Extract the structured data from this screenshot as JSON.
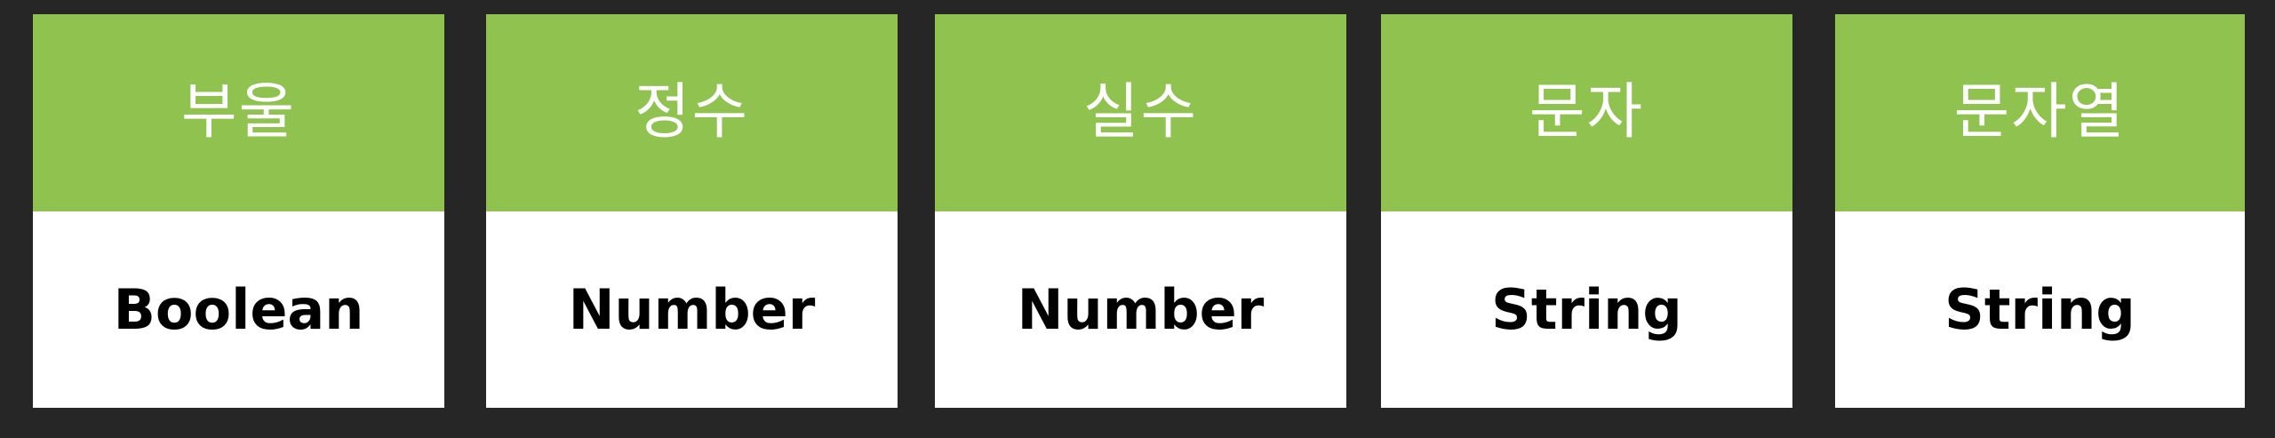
{
  "cards": [
    {
      "korean": "부울",
      "english": "Boolean"
    },
    {
      "korean": "정수",
      "english": "Number"
    },
    {
      "korean": "실수",
      "english": "Number"
    },
    {
      "korean": "문자",
      "english": "String"
    },
    {
      "korean": "문자열",
      "english": "String"
    }
  ],
  "colors": {
    "background": "#262626",
    "header": "#8fc24e",
    "body": "#ffffff",
    "header_text": "#ffffff",
    "body_text": "#000000"
  }
}
